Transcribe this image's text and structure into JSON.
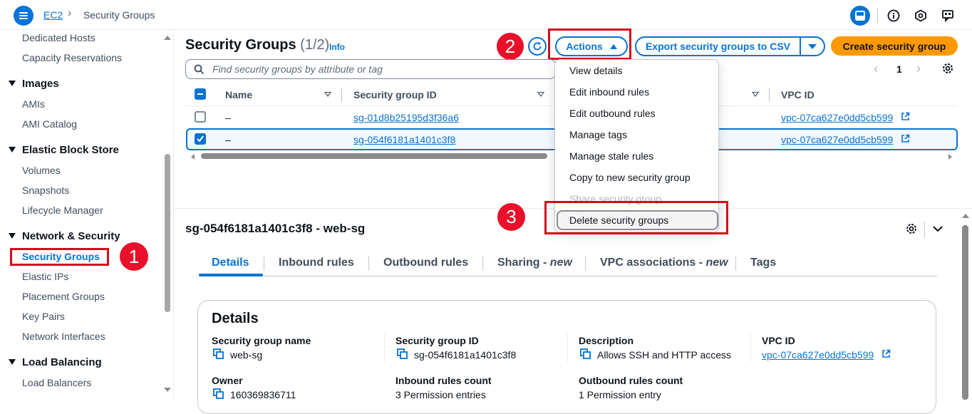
{
  "breadcrumb": {
    "service": "EC2",
    "current": "Security Groups"
  },
  "sidebar": {
    "items": [
      {
        "label": "Dedicated Hosts"
      },
      {
        "label": "Capacity Reservations"
      }
    ],
    "sections": [
      {
        "title": "Images",
        "items": [
          "AMIs",
          "AMI Catalog"
        ]
      },
      {
        "title": "Elastic Block Store",
        "items": [
          "Volumes",
          "Snapshots",
          "Lifecycle Manager"
        ]
      },
      {
        "title": "Network & Security",
        "items": [
          "Security Groups",
          "Elastic IPs",
          "Placement Groups",
          "Key Pairs",
          "Network Interfaces"
        ]
      },
      {
        "title": "Load Balancing",
        "items": [
          "Load Balancers"
        ]
      }
    ]
  },
  "annotations": {
    "badge1": "1",
    "badge2": "2",
    "badge3": "3"
  },
  "header": {
    "title": "Security Groups",
    "count": "(1/2)",
    "info": "Info",
    "actions_label": "Actions",
    "export_label": "Export security groups to CSV",
    "create_label": "Create security group",
    "search_placeholder": "Find security groups by attribute or tag",
    "page_number": "1"
  },
  "table": {
    "columns": [
      "Name",
      "Security group ID",
      "VPC ID"
    ],
    "rows": [
      {
        "name": "–",
        "id": "sg-01d8b25195d3f36a6",
        "vpc": "vpc-07ca627e0dd5cb599",
        "selected": false
      },
      {
        "name": "–",
        "id": "sg-054f6181a1401c3f8",
        "vpc": "vpc-07ca627e0dd5cb599",
        "selected": true
      }
    ]
  },
  "actions_menu": {
    "items": [
      "View details",
      "Edit inbound rules",
      "Edit outbound rules",
      "Manage tags",
      "Manage stale rules",
      "Copy to new security group",
      "Share security group",
      "Delete security groups"
    ],
    "disabled_item": "Share security group",
    "highlighted_item": "Delete security groups"
  },
  "details": {
    "title": "sg-054f6181a1401c3f8 - web-sg",
    "tabs": [
      {
        "label": "Details",
        "new": ""
      },
      {
        "label": "Inbound rules",
        "new": ""
      },
      {
        "label": "Outbound rules",
        "new": ""
      },
      {
        "label": "Sharing - ",
        "new": "new"
      },
      {
        "label": "VPC associations - ",
        "new": "new"
      },
      {
        "label": "Tags",
        "new": ""
      }
    ],
    "card_title": "Details",
    "fields": {
      "sg_name_label": "Security group name",
      "sg_name": "web-sg",
      "sg_id_label": "Security group ID",
      "sg_id": "sg-054f6181a1401c3f8",
      "desc_label": "Description",
      "desc": "Allows SSH and HTTP access",
      "vpc_label": "VPC ID",
      "vpc": "vpc-07ca627e0dd5cb599",
      "owner_label": "Owner",
      "owner": "160369836711",
      "inbound_label": "Inbound rules count",
      "inbound": "3 Permission entries",
      "outbound_label": "Outbound rules count",
      "outbound": "1 Permission entry"
    }
  },
  "colors": {
    "accent": "#0972d3",
    "primary_button": "#ff9900",
    "annotation_red": "#d40c1c"
  }
}
